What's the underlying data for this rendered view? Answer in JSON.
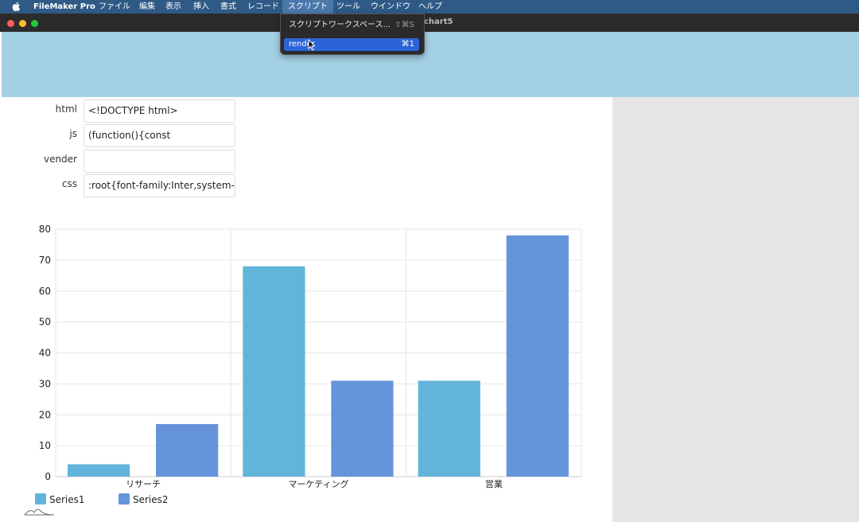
{
  "menubar": {
    "app_name": "FileMaker Pro",
    "items": [
      "ファイル",
      "編集",
      "表示",
      "挿入",
      "書式",
      "レコード",
      "スクリプト",
      "ツール",
      "ウインドウ",
      "ヘルプ"
    ]
  },
  "window": {
    "title": "chart5"
  },
  "script_menu": {
    "items": [
      {
        "label": "スクリプトワークスペース...",
        "shortcut": "⇧⌘S"
      },
      {
        "label": "render",
        "shortcut": "⌘1"
      }
    ]
  },
  "fields": [
    {
      "label": "html",
      "value": "<!DOCTYPE html>"
    },
    {
      "label": "js",
      "value": "(function(){const"
    },
    {
      "label": "vender",
      "value": ""
    },
    {
      "label": "css",
      "value": ":root{font-family:Inter,system-"
    }
  ],
  "colors": {
    "series1": "#63b4da",
    "series2": "#6694db",
    "header_band": "#a3d0e4",
    "menubar": "#2f5a86"
  },
  "chart_data": {
    "type": "bar",
    "categories": [
      "リサーチ",
      "マーケティング",
      "営業"
    ],
    "series": [
      {
        "name": "Series1",
        "values": [
          4,
          68,
          31
        ]
      },
      {
        "name": "Series2",
        "values": [
          17,
          31,
          78
        ]
      }
    ],
    "ylim": [
      0,
      80
    ],
    "yticks": [
      "0",
      "10",
      "20",
      "30",
      "40",
      "50",
      "60",
      "70",
      "80"
    ],
    "grid": true,
    "legend_position": "bottom-left"
  }
}
